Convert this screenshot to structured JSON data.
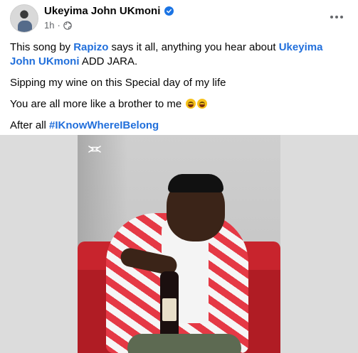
{
  "post": {
    "author": "Ukeyima John UKmoni",
    "time": "1h",
    "dot": "·",
    "text": {
      "p1_a": "This song by ",
      "p1_mention1": "Rapizo",
      "p1_b": " says it all, anything you hear about ",
      "p1_mention2": "Ukeyima John UKmoni",
      "p1_c": " ADD JARA.",
      "p2": "Sipping my wine on this Special day of my life",
      "p3": "You are all more like a brother to me ",
      "p4_a": "After all ",
      "p4_hashtag": "#IKnowWhereIBelong"
    }
  },
  "icons": {
    "verified": "verified-badge-icon",
    "privacy": "globe-icon",
    "more": "more-options-icon",
    "emoji": "laughing-emoji-icon",
    "watermark": "capcut-logo-icon"
  },
  "colors": {
    "link": "#216fdb",
    "verified": "#1b74e4",
    "meta": "#65676b"
  }
}
